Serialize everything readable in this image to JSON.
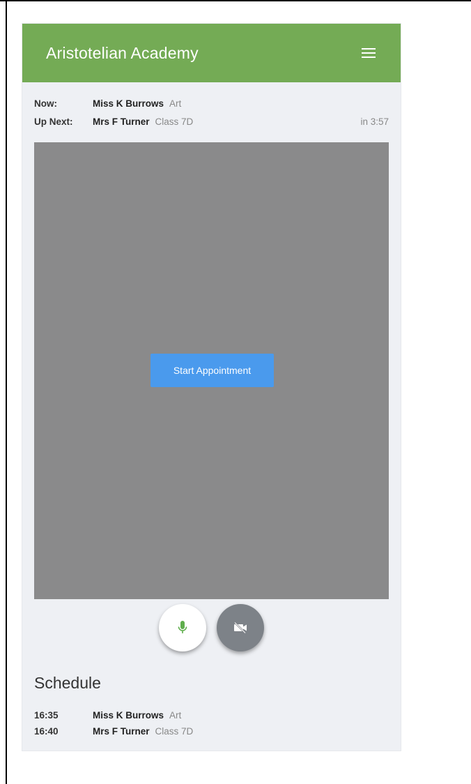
{
  "app": {
    "title": "Aristotelian Academy"
  },
  "now": {
    "label": "Now:",
    "name": "Miss K Burrows",
    "subject": "Art"
  },
  "up_next": {
    "label": "Up Next:",
    "name": "Mrs F Turner",
    "subject": "Class 7D",
    "countdown": "in 3:57"
  },
  "video": {
    "start_button_label": "Start Appointment"
  },
  "controls": {
    "mic": {
      "icon": "microphone-icon",
      "state": "on",
      "color": "#5fae4c"
    },
    "camera": {
      "icon": "video-off-icon",
      "state": "off"
    }
  },
  "schedule": {
    "title": "Schedule",
    "items": [
      {
        "time": "16:35",
        "name": "Miss K Burrows",
        "subject": "Art"
      },
      {
        "time": "16:40",
        "name": "Mrs F Turner",
        "subject": "Class 7D"
      }
    ]
  },
  "colors": {
    "header": "#74ab55",
    "button": "#4a9aed",
    "video_bg": "#8a8a8b",
    "panel_bg": "#eef0f4"
  }
}
